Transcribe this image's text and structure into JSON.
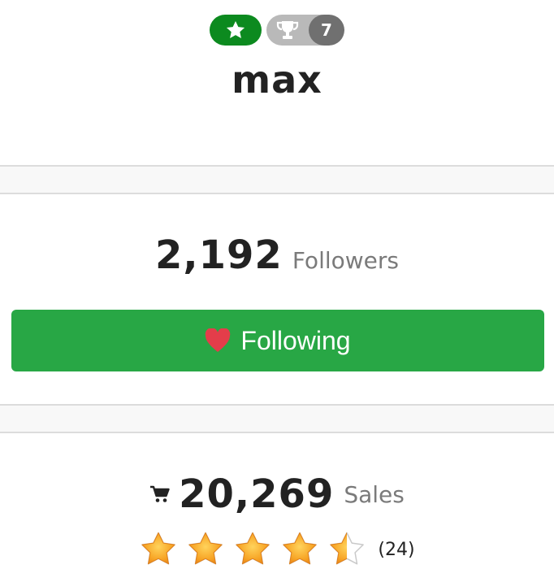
{
  "profile": {
    "username": "max",
    "trophy_count": "7",
    "badges": {
      "star_color": "#0c8a1f",
      "trophy_bg": "#b9b9b9",
      "count_bg": "#707070"
    }
  },
  "followers": {
    "count": "2,192",
    "label": "Followers"
  },
  "follow_button": {
    "label": "Following",
    "icon": "heart-icon",
    "bg_color": "#28a745",
    "heart_color": "#e43d4a"
  },
  "sales": {
    "icon": "cart-icon",
    "count": "20,269",
    "label": "Sales"
  },
  "rating": {
    "stars_value": 4.5,
    "stars_max": 5,
    "count_text": "(24)",
    "star_color": "#f7a425"
  }
}
